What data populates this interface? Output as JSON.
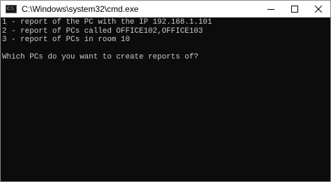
{
  "window": {
    "title": "C:\\Windows\\system32\\cmd.exe",
    "icon": "cmd-icon",
    "icon_text": "C:\\"
  },
  "caption_buttons": {
    "minimize": "minimize-icon",
    "maximize": "maximize-icon",
    "close": "close-icon"
  },
  "console": {
    "lines": [
      "1 - report of the PC with the IP 192.168.1.101",
      "2 - report of PCs called OFFICE102,OFFICE103",
      "3 - report of PCs in room 10",
      "",
      "Which PCs do you want to create reports of?"
    ],
    "foreground": "#cccccc",
    "background": "#0c0c0c"
  }
}
